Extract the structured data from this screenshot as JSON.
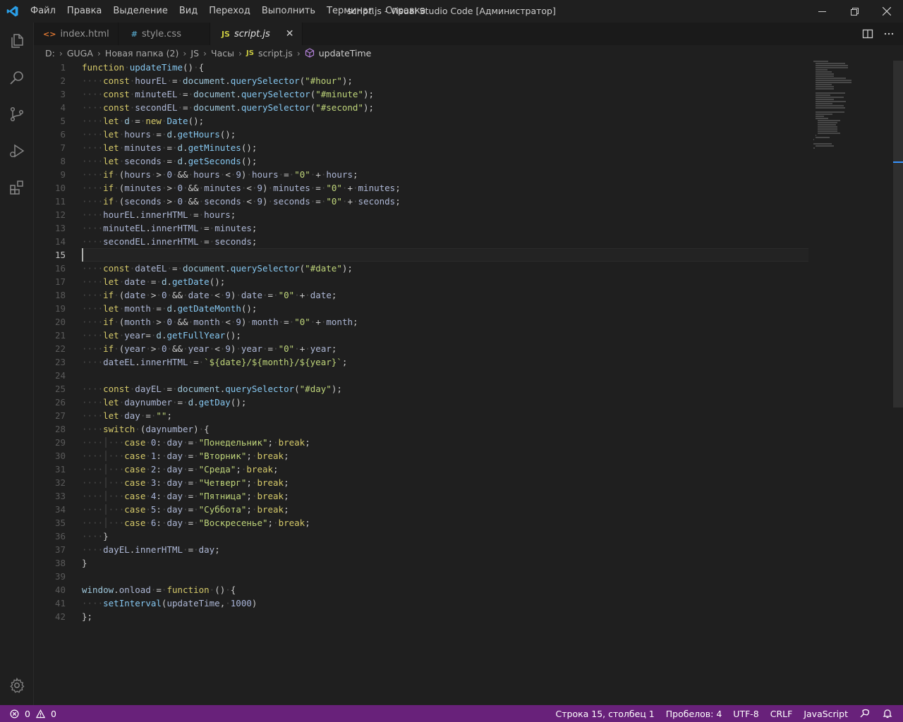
{
  "window": {
    "title": "script.js - Visual Studio Code [Администратор]"
  },
  "menu": [
    "Файл",
    "Правка",
    "Выделение",
    "Вид",
    "Переход",
    "Выполнить",
    "Терминал",
    "Справка"
  ],
  "tabs": [
    {
      "label": "index.html",
      "icon": "html-file-icon",
      "icon_text": "<>",
      "icon_color": "#e37933"
    },
    {
      "label": "style.css",
      "icon": "css-file-icon",
      "icon_text": "#",
      "icon_color": "#519aba"
    },
    {
      "label": "script.js",
      "icon": "js-file-icon",
      "icon_text": "JS",
      "icon_color": "#cbcb41",
      "active": true
    }
  ],
  "breadcrumb": [
    "D:",
    "GUGA",
    "Новая папка (2)",
    "JS",
    "Часы",
    "script.js",
    "updateTime"
  ],
  "code": {
    "line_numbers": [
      "1",
      "2",
      "3",
      "4",
      "5",
      "6",
      "7",
      "8",
      "9",
      "10",
      "11",
      "12",
      "13",
      "14",
      "15",
      "16",
      "17",
      "18",
      "19",
      "20",
      "21",
      "22",
      "23",
      "24",
      "25",
      "26",
      "27",
      "28",
      "29",
      "30",
      "31",
      "32",
      "33",
      "34",
      "35",
      "36",
      "37",
      "38",
      "39",
      "40",
      "41",
      "42"
    ],
    "lines": [
      "function updateTime() {",
      "    const hourEL = document.querySelector(\"#hour\");",
      "    const minuteEL = document.querySelector(\"#minute\");",
      "    const secondEL = document.querySelector(\"#second\");",
      "    let d = new Date();",
      "    let hours = d.getHours();",
      "    let minutes = d.getMinutes();",
      "    let seconds = d.getSeconds();",
      "    if (hours > 0 && hours < 9) hours = \"0\" + hours;",
      "    if (minutes > 0 && minutes < 9) minutes = \"0\" + minutes;",
      "    if (seconds > 0 && seconds < 9) seconds = \"0\" + seconds;",
      "    hourEL.innerHTML = hours;",
      "    minuteEL.innerHTML = minutes;",
      "    secondEL.innerHTML = seconds;",
      "",
      "    const dateEL = document.querySelector(\"#date\");",
      "    let date = d.getDate();",
      "    if (date > 0 && date < 9) date = \"0\" + date;",
      "    let month = d.getDateMonth();",
      "    if (month > 0 && month < 9) month = \"0\" + month;",
      "    let year= d.getFullYear();",
      "    if (year > 0 && year < 9) year = \"0\" + year;",
      "    dateEL.innerHTML = `${date}/${month}/${year}`;",
      "",
      "    const dayEL = document.querySelector(\"#day\");",
      "    let daynumber = d.getDay();",
      "    let day = \"\";",
      "    switch (daynumber) {",
      "        case 0: day = \"Понедельник\"; break;",
      "        case 1: day = \"Вторник\"; break;",
      "        case 2: day = \"Среда\"; break;",
      "        case 3: day = \"Четверг\"; break;",
      "        case 4: day = \"Пятница\"; break;",
      "        case 5: day = \"Суббота\"; break;",
      "        case 6: day = \"Воскресенье\"; break;",
      "    }",
      "    dayEL.innerHTML = day;",
      "}",
      "",
      "window.onload = function () {",
      "    setInterval(updateTime, 1000)",
      "};"
    ]
  },
  "colors": {
    "keyword": "#d6ca6a",
    "string": "#bfd57a",
    "function": "#86c7f0",
    "variable": "#aeb8d6",
    "number": "#a8b5d9",
    "punct": "#c9c9c9",
    "statusbar": "#68217a"
  },
  "status": {
    "errors": "0",
    "warnings": "0",
    "position": "Строка 15, столбец 1",
    "indent": "Пробелов: 4",
    "encoding": "UTF-8",
    "eol": "CRLF",
    "language": "JavaScript"
  }
}
